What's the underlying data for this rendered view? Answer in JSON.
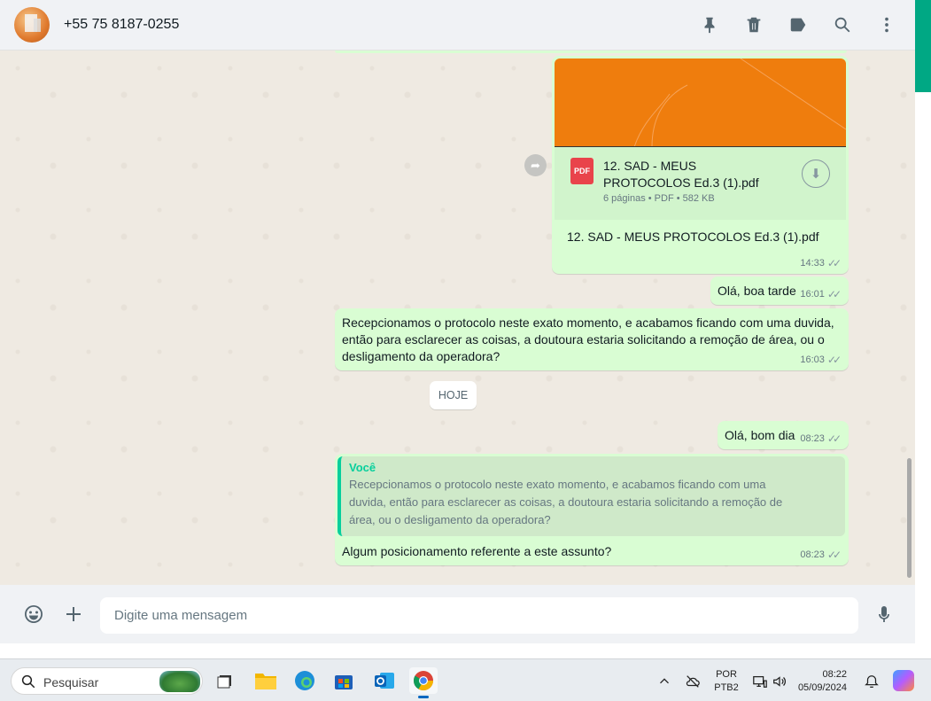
{
  "header": {
    "contact_name": "+55 75 8187-0255",
    "icons": [
      "pin-icon",
      "delete-icon",
      "label-icon",
      "search-icon",
      "more-icon"
    ]
  },
  "messages": {
    "document": {
      "file_name": "12. SAD - MEUS PROTOCOLOS Ed.3 (1).pdf",
      "pdf_badge": "PDF",
      "details": "6 páginas • PDF • 582 KB",
      "caption": "12. SAD - MEUS PROTOCOLOS Ed.3 (1).pdf",
      "time": "14:33"
    },
    "greeting_afternoon": {
      "text": "Olá, boa tarde",
      "time": "16:01"
    },
    "question": {
      "text": "Recepcionamos o protocolo neste exato momento, e acabamos ficando com uma duvida, então para esclarecer as coisas, a doutoura estaria solicitando a remoção de área, ou o desligamento da operadora?",
      "time": "16:03"
    },
    "date_divider": "HOJE",
    "greeting_morning": {
      "text": "Olá, bom dia",
      "time": "08:23"
    },
    "reply": {
      "quote_author": "Você",
      "quote_text": "Recepcionamos o protocolo neste exato momento, e acabamos ficando com uma duvida, então para esclarecer as coisas, a doutoura estaria solicitando a remoção de área, ou o desligamento da operadora?",
      "text": "Algum posicionamento referente a este assunto?",
      "time": "08:23"
    }
  },
  "composer": {
    "placeholder": "Digite uma mensagem"
  },
  "taskbar": {
    "search_label": "Pesquisar",
    "language_line1": "POR",
    "language_line2": "PTB2",
    "time": "08:22",
    "date": "05/09/2024"
  },
  "colors": {
    "outgoing_bubble": "#d9fdd3",
    "accent": "#00a884",
    "chat_background": "#efeae2"
  }
}
